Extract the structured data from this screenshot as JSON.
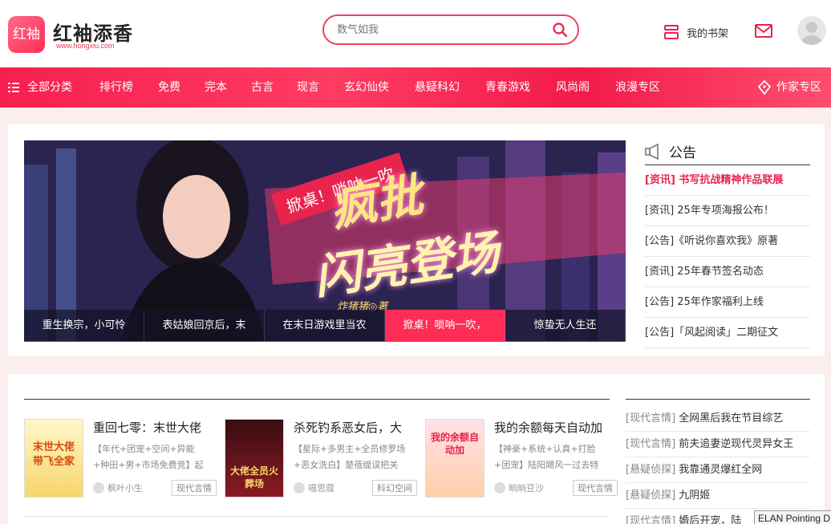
{
  "header": {
    "logo_mark": "红袖",
    "logo_name": "红袖添香",
    "logo_url": "www.hongxiu.com",
    "search_placeholder": "数气如我",
    "shelf_label": "我的书架"
  },
  "nav": {
    "all_label": "全部分类",
    "items": [
      "排行榜",
      "免费",
      "完本",
      "古言",
      "现言",
      "玄幻仙侠",
      "悬疑科幻",
      "青春游戏",
      "风尚阁",
      "浪漫专区"
    ],
    "author_zone": "作家专区"
  },
  "banner": {
    "ribbon": "掀桌！唢呐一吹",
    "title_line1": "疯批",
    "title_line2": "闪亮登场",
    "author": "炸猪猪◎著",
    "tabs": [
      "重生换宗，小可怜",
      "表姑娘回京后，末",
      "在末日游戏里当农",
      "掀桌！唢呐一吹，",
      "惊蛰无人生还"
    ],
    "active_tab": 3
  },
  "notice": {
    "heading": "公告",
    "items": [
      "[资讯] 书写抗战精神作品联展",
      "[资讯] 25年专项海报公布！",
      "[公告]《听说你喜欢我》原著",
      "[资讯] 25年春节签名动态",
      "[公告] 25年作家福利上线",
      "[公告]「风起阅读」二期征文"
    ]
  },
  "books": [
    {
      "title": "重回七零：末世大佬",
      "desc": "【年代+团宠+空间+异能+种田+男+市场免费竞】起于",
      "author": "枫叶小生",
      "tag": "现代言情",
      "cover_text": "末世大佬带飞全家"
    },
    {
      "title": "杀死钓系恶女后，大",
      "desc": "【星际+多男主+全员修罗场+恶女洗白】楚蓓缇误把关",
      "author": "喵思蔻",
      "tag": "科幻空间",
      "cover_text": "大佬全员火葬场"
    },
    {
      "title": "我的余额每天自动加",
      "desc": "【神豪+系统+认真+打脸+团宠】陆阳飓风一过去特别，",
      "author": "晌晌豆沙",
      "tag": "现代言情",
      "cover_text": "我的余额自动加"
    }
  ],
  "rank": [
    {
      "cat": "[现代言情]",
      "title": "全网黑后我在节目综艺"
    },
    {
      "cat": "[现代言情]",
      "title": "前夫追妻逆现代灵异女王"
    },
    {
      "cat": "[悬疑侦探]",
      "title": "我靠通灵爆红全网"
    },
    {
      "cat": "[悬疑侦探]",
      "title": "九阴姬"
    },
    {
      "cat": "[现代言情]",
      "title": "婚后开宠，陆"
    }
  ],
  "tooltip": "ELAN Pointing D",
  "colors": {
    "brand": "#ff2d55",
    "nav": "#f6204f"
  }
}
